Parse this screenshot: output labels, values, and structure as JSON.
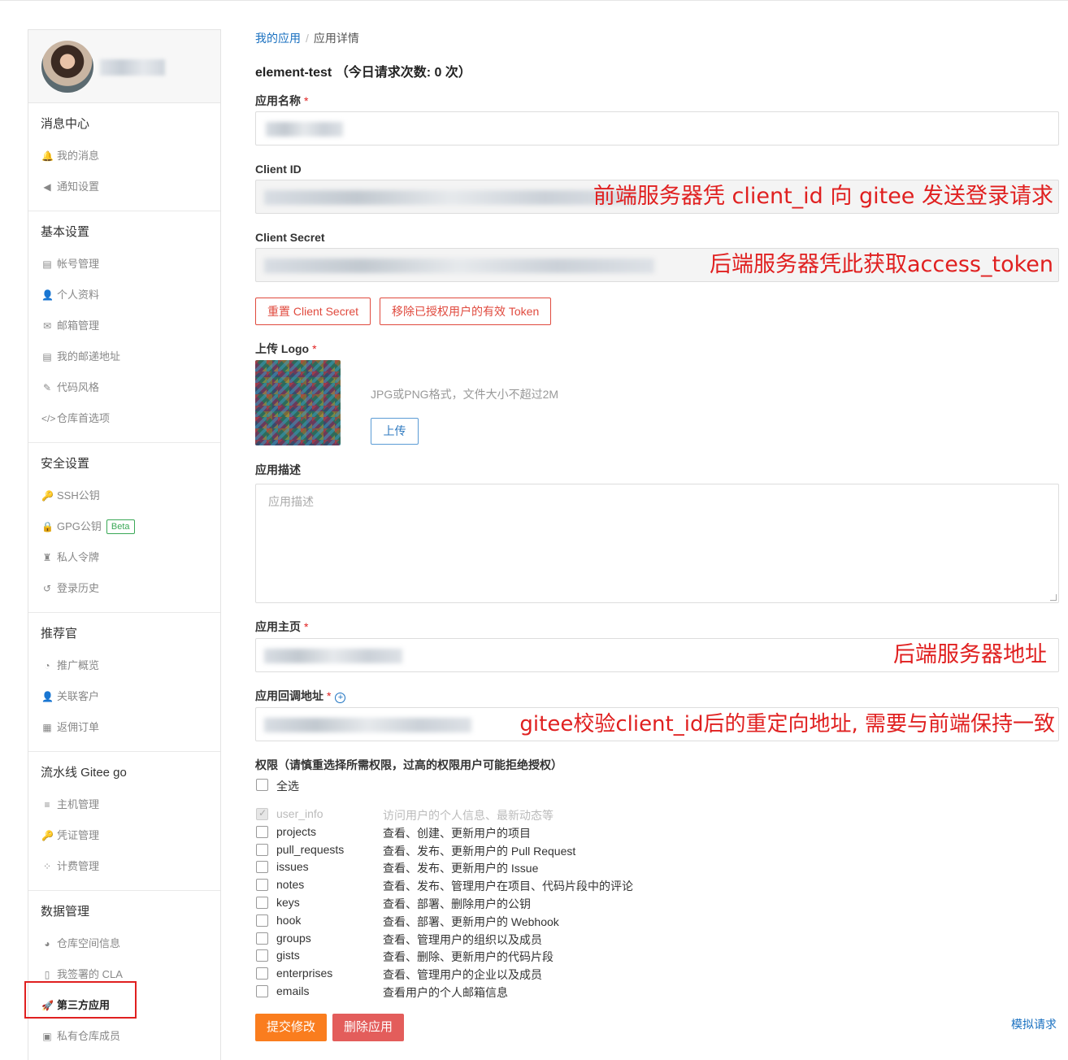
{
  "breadcrumb": {
    "parent": "我的应用",
    "sep": "/",
    "current": "应用详情"
  },
  "app": {
    "title": "element-test （今日请求次数: 0 次）"
  },
  "form": {
    "name_label": "应用名称",
    "client_id_label": "Client ID",
    "client_secret_label": "Client Secret",
    "reset_secret_label": "重置 Client Secret",
    "revoke_token_label": "移除已授权用户的有效 Token",
    "logo_label": "上传 Logo",
    "logo_hint": "JPG或PNG格式，文件大小不超过2M",
    "upload_label": "上传",
    "desc_label": "应用描述",
    "desc_placeholder": "应用描述",
    "homepage_label": "应用主页",
    "callback_label": "应用回调地址",
    "help_icon_glyph": "+",
    "required_mark": "*",
    "scopes_label": "权限（请慎重选择所需权限，过高的权限用户可能拒绝授权）",
    "select_all_label": "全选",
    "submit_label": "提交修改",
    "delete_label": "删除应用",
    "simulate_label": "模拟请求"
  },
  "annotations": {
    "client_id": "前端服务器凭 client_id 向 gitee 发送登录请求",
    "client_secret": "后端服务器凭此获取access_token",
    "homepage": "后端服务器地址",
    "callback": "gitee校验client_id后的重定向地址, 需要与前端保持一致"
  },
  "scopes": [
    {
      "name": "user_info",
      "desc": "访问用户的个人信息、最新动态等",
      "checked": true,
      "disabled": true
    },
    {
      "name": "projects",
      "desc": "查看、创建、更新用户的项目",
      "checked": false
    },
    {
      "name": "pull_requests",
      "desc": "查看、发布、更新用户的 Pull Request",
      "checked": false
    },
    {
      "name": "issues",
      "desc": "查看、发布、更新用户的 Issue",
      "checked": false
    },
    {
      "name": "notes",
      "desc": "查看、发布、管理用户在项目、代码片段中的评论",
      "checked": false
    },
    {
      "name": "keys",
      "desc": "查看、部署、删除用户的公钥",
      "checked": false
    },
    {
      "name": "hook",
      "desc": "查看、部署、更新用户的 Webhook",
      "checked": false
    },
    {
      "name": "groups",
      "desc": "查看、管理用户的组织以及成员",
      "checked": false
    },
    {
      "name": "gists",
      "desc": "查看、删除、更新用户的代码片段",
      "checked": false
    },
    {
      "name": "enterprises",
      "desc": "查看、管理用户的企业以及成员",
      "checked": false
    },
    {
      "name": "emails",
      "desc": "查看用户的个人邮箱信息",
      "checked": false
    }
  ],
  "sidebar": {
    "groups": [
      {
        "title": "消息中心",
        "items": [
          {
            "label": "我的消息",
            "icon": "bell-icon",
            "glyph": "🔔"
          },
          {
            "label": "通知设置",
            "icon": "speaker-icon",
            "glyph": "◀"
          }
        ]
      },
      {
        "title": "基本设置",
        "items": [
          {
            "label": "帐号管理",
            "icon": "id-card-icon",
            "glyph": "▤"
          },
          {
            "label": "个人资料",
            "icon": "user-icon",
            "glyph": "👤"
          },
          {
            "label": "邮箱管理",
            "icon": "mail-icon",
            "glyph": "✉"
          },
          {
            "label": "我的邮递地址",
            "icon": "address-card-icon",
            "glyph": "▤"
          },
          {
            "label": "代码风格",
            "icon": "brush-icon",
            "glyph": "✎"
          },
          {
            "label": "仓库首选项",
            "icon": "code-icon",
            "glyph": "</>"
          }
        ]
      },
      {
        "title": "安全设置",
        "items": [
          {
            "label": "SSH公钥",
            "icon": "key-icon",
            "glyph": "🔑"
          },
          {
            "label": "GPG公钥",
            "icon": "lock-icon",
            "glyph": "🔒",
            "badge": "Beta"
          },
          {
            "label": "私人令牌",
            "icon": "token-icon",
            "glyph": "♜"
          },
          {
            "label": "登录历史",
            "icon": "history-icon",
            "glyph": "↺"
          }
        ]
      },
      {
        "title": "推荐官",
        "items": [
          {
            "label": "推广概览",
            "icon": "gauge-icon",
            "glyph": "◔"
          },
          {
            "label": "关联客户",
            "icon": "user-link-icon",
            "glyph": "👤"
          },
          {
            "label": "返佣订单",
            "icon": "order-icon",
            "glyph": "▦"
          }
        ]
      },
      {
        "title": "流水线 Gitee go",
        "items": [
          {
            "label": "主机管理",
            "icon": "server-icon",
            "glyph": "≡"
          },
          {
            "label": "凭证管理",
            "icon": "key-icon",
            "glyph": "🔑"
          },
          {
            "label": "计费管理",
            "icon": "billing-icon",
            "glyph": "⁘"
          }
        ]
      },
      {
        "title": "数据管理",
        "items": [
          {
            "label": "仓库空间信息",
            "icon": "pie-icon",
            "glyph": "◕"
          },
          {
            "label": "我签署的 CLA",
            "icon": "file-icon",
            "glyph": "▯"
          },
          {
            "label": "第三方应用",
            "icon": "rocket-icon",
            "glyph": "🚀",
            "active": true
          },
          {
            "label": "私有仓库成员",
            "icon": "member-icon",
            "glyph": "▣"
          }
        ]
      }
    ]
  },
  "colors": {
    "link": "#1970c0",
    "danger": "#e04a3e",
    "submit": "#fa7d1e",
    "delete": "#e35d5b",
    "annotation": "#e02020"
  }
}
